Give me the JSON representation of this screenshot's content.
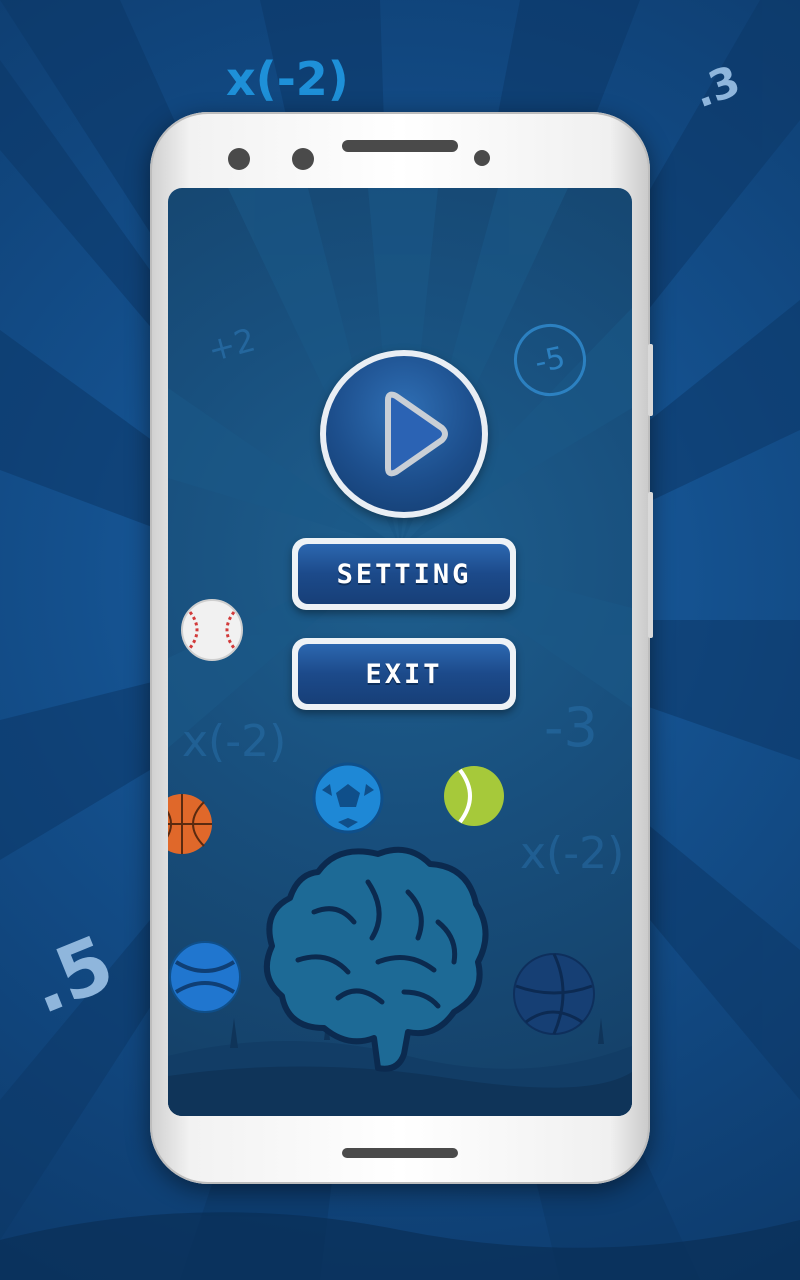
{
  "background": {
    "decor_numbers": [
      "x(-2)",
      ".3",
      ".5"
    ]
  },
  "screen": {
    "decor_numbers": [
      "+2",
      "-5",
      "x(-2)",
      "-3",
      "x(-2)"
    ]
  },
  "menu": {
    "play_icon": "play-icon",
    "setting_label": "SETTING",
    "exit_label": "EXIT"
  },
  "colors": {
    "background": "#14508d",
    "screen": "#184f7d",
    "button_fill": "#1c4a8a",
    "button_border": "#eef2f6",
    "phone_body": "#f2f2f2"
  }
}
